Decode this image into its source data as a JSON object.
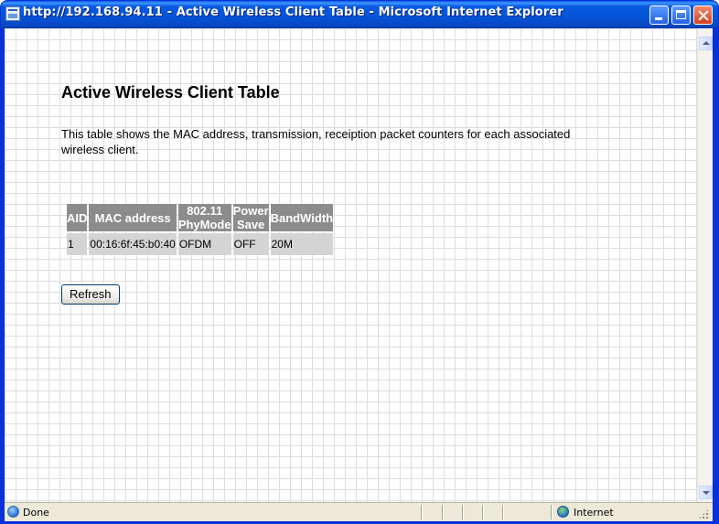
{
  "window": {
    "title": "http://192.168.94.11 - Active Wireless Client Table - Microsoft Internet Explorer"
  },
  "page": {
    "heading": "Active Wireless Client Table",
    "description": "This table shows the MAC address, transmission, receiption packet counters for each associated wireless client.",
    "table": {
      "headers": [
        "AID",
        "MAC address",
        "802.11 PhyMode",
        "Power Save",
        "BandWidth"
      ],
      "rows": [
        [
          "1",
          "00:16:6f:45:b0:40",
          "OFDM",
          "OFF",
          "20M"
        ]
      ]
    },
    "refresh_label": "Refresh"
  },
  "statusbar": {
    "status_text": "Done",
    "zone_text": "Internet"
  },
  "icons": {
    "window": "ie-page-icon",
    "status": "ie-page-done-icon",
    "zone": "internet-globe-icon"
  }
}
